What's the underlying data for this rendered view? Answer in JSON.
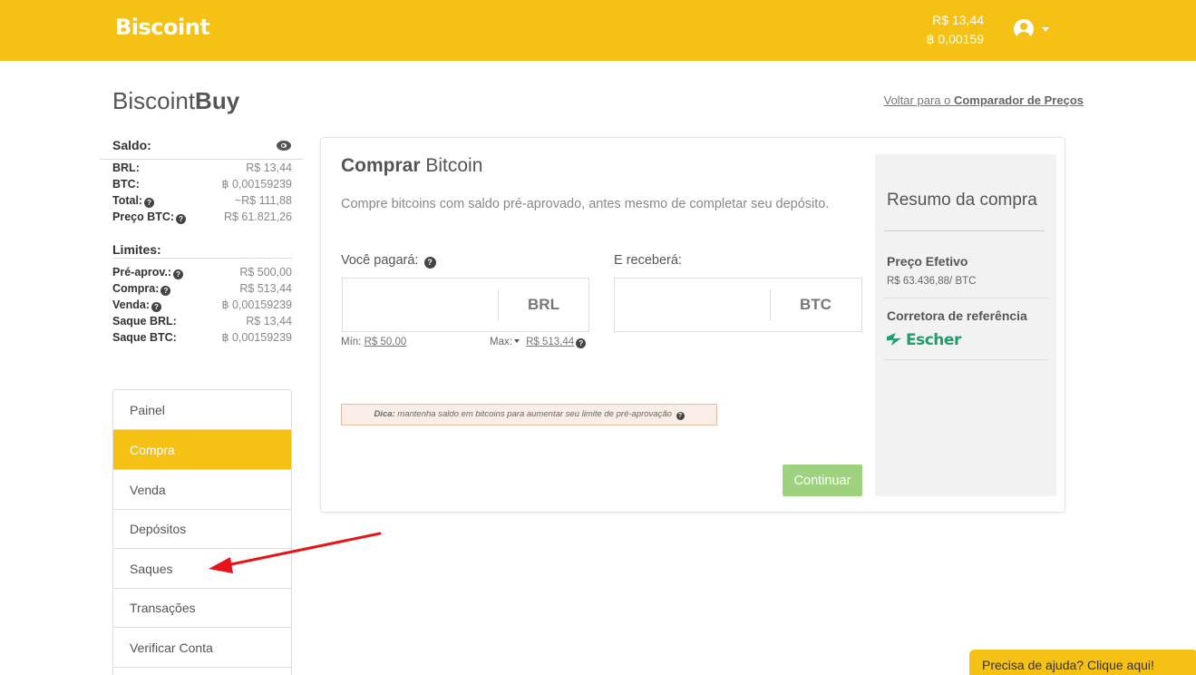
{
  "header": {
    "logo": "Biscoint",
    "balance_brl": "R$ 13,44",
    "balance_btc": "฿ 0,00159"
  },
  "page": {
    "title_light": "Biscoint",
    "title_bold": "Buy",
    "back_prefix": "Voltar para o ",
    "back_link": "Comparador de Preços"
  },
  "saldo": {
    "heading": "Saldo:",
    "rows": [
      {
        "label": "BRL:",
        "value": "R$ 13,44"
      },
      {
        "label": "BTC:",
        "value": "฿ 0,00159239"
      },
      {
        "label": "Total:",
        "value": "~R$ 111,88"
      },
      {
        "label": "Preço BTC:",
        "value": "R$ 61.821,26"
      }
    ]
  },
  "limites": {
    "heading": "Limites:",
    "rows": [
      {
        "label": "Pré-aprov.:",
        "value": "R$ 500,00"
      },
      {
        "label": "Compra:",
        "value": "R$ 513,44"
      },
      {
        "label": "Venda:",
        "value": "฿ 0,00159239"
      },
      {
        "label": "Saque BRL:",
        "value": "R$ 13,44"
      },
      {
        "label": "Saque BTC:",
        "value": "฿ 0,00159239"
      }
    ]
  },
  "nav": {
    "items": [
      "Painel",
      "Compra",
      "Venda",
      "Depósitos",
      "Saques",
      "Transações",
      "Verificar Conta"
    ],
    "active": "Compra"
  },
  "buy": {
    "title_bold": "Comprar",
    "title_light": " Bitcoin",
    "subtitle": "Compre bitcoins com saldo pré-aprovado, antes mesmo de completar seu depósito.",
    "pay_label": "Você pagará:",
    "pay_unit": "BRL",
    "pay_value": "",
    "receive_label": "E receberá:",
    "receive_unit": "BTC",
    "receive_value": "",
    "min_label": "Mín:",
    "min_value": "R$ 50,00",
    "max_label": "Max:",
    "max_value": "R$ 513,44",
    "tip_bold": "Dica:",
    "tip_text": " mantenha saldo em bitcoins para aumentar seu limite de pré-aprovação",
    "continue_label": "Continuar"
  },
  "summary": {
    "title": "Resumo da compra",
    "price_label": "Preço Efetivo",
    "price_value": "R$ 63.436,88/ BTC",
    "broker_label": "Corretora de referência",
    "broker_name": "Escher"
  },
  "help": {
    "label": "Precisa de ajuda? Clique aqui!"
  },
  "colors": {
    "brand": "#f4c114",
    "continue": "#9ed27e",
    "escher": "#1f9e6b",
    "annotation_arrow": "#e8141a"
  }
}
